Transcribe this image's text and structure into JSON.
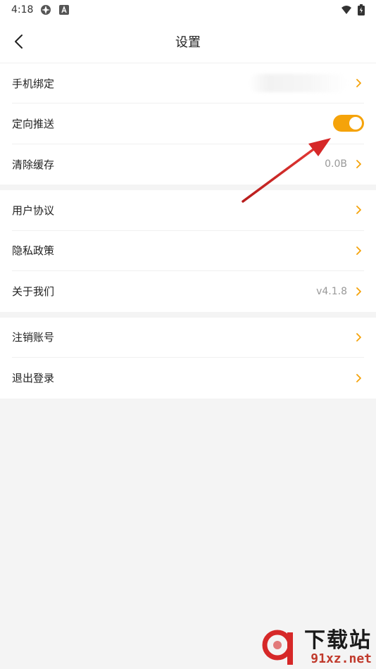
{
  "status": {
    "time": "4:18"
  },
  "header": {
    "title": "设置"
  },
  "groups": [
    {
      "items": [
        {
          "label": "手机绑定",
          "value": ""
        },
        {
          "label": "定向推送",
          "toggle_on": true
        },
        {
          "label": "清除缓存",
          "value": "0.0B"
        }
      ]
    },
    {
      "items": [
        {
          "label": "用户协议"
        },
        {
          "label": "隐私政策"
        },
        {
          "label": "关于我们",
          "value": "v4.1.8"
        }
      ]
    },
    {
      "items": [
        {
          "label": "注销账号"
        },
        {
          "label": "退出登录"
        }
      ]
    }
  ],
  "watermark": {
    "brand_text": "下载站",
    "url_text": "91xz.net"
  },
  "colors": {
    "accent": "#f5a30a",
    "chevron": "#f5a30a",
    "annotation_arrow": "#d62828"
  }
}
